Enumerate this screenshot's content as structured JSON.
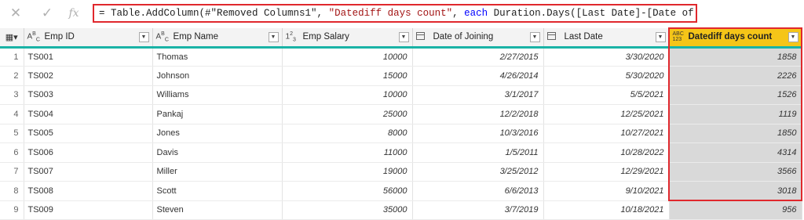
{
  "formula_bar": {
    "prefix": "= Table.AddColumn(#\"Removed Columns1\", ",
    "string_part": "\"Datediff days count\"",
    "middle": ", ",
    "keyword": "each",
    "suffix": " Duration.Days([Last Date]-[Date of Joining]))"
  },
  "columns": [
    {
      "label": "Emp ID",
      "type_icon": "text-type-icon"
    },
    {
      "label": "Emp Name",
      "type_icon": "text-type-icon"
    },
    {
      "label": "Emp Salary",
      "type_icon": "number-type-icon"
    },
    {
      "label": "Date of Joining",
      "type_icon": "date-type-icon"
    },
    {
      "label": "Last Date",
      "type_icon": "date-type-icon"
    },
    {
      "label": "Datediff days count",
      "type_icon": "any-type-icon"
    }
  ],
  "rows": [
    {
      "n": "1",
      "id": "TS001",
      "name": "Thomas",
      "salary": "10000",
      "doj": "2/27/2015",
      "last": "3/30/2020",
      "diff": "1858"
    },
    {
      "n": "2",
      "id": "TS002",
      "name": "Johnson",
      "salary": "15000",
      "doj": "4/26/2014",
      "last": "5/30/2020",
      "diff": "2226"
    },
    {
      "n": "3",
      "id": "TS003",
      "name": "Williams",
      "salary": "10000",
      "doj": "3/1/2017",
      "last": "5/5/2021",
      "diff": "1526"
    },
    {
      "n": "4",
      "id": "TS004",
      "name": "Pankaj",
      "salary": "25000",
      "doj": "12/2/2018",
      "last": "12/25/2021",
      "diff": "1119"
    },
    {
      "n": "5",
      "id": "TS005",
      "name": "Jones",
      "salary": "8000",
      "doj": "10/3/2016",
      "last": "10/27/2021",
      "diff": "1850"
    },
    {
      "n": "6",
      "id": "TS006",
      "name": "Davis",
      "salary": "11000",
      "doj": "1/5/2011",
      "last": "10/28/2022",
      "diff": "4314"
    },
    {
      "n": "7",
      "id": "TS007",
      "name": "Miller",
      "salary": "19000",
      "doj": "3/25/2012",
      "last": "12/29/2021",
      "diff": "3566"
    },
    {
      "n": "8",
      "id": "TS008",
      "name": "Scott",
      "salary": "56000",
      "doj": "6/6/2013",
      "last": "9/10/2021",
      "diff": "3018"
    },
    {
      "n": "9",
      "id": "TS009",
      "name": "Steven",
      "salary": "35000",
      "doj": "3/7/2019",
      "last": "10/18/2021",
      "diff": "956"
    }
  ],
  "colors": {
    "highlight": "#f5c518",
    "border": "#e0282d",
    "header_line": "#1ab3a6"
  }
}
